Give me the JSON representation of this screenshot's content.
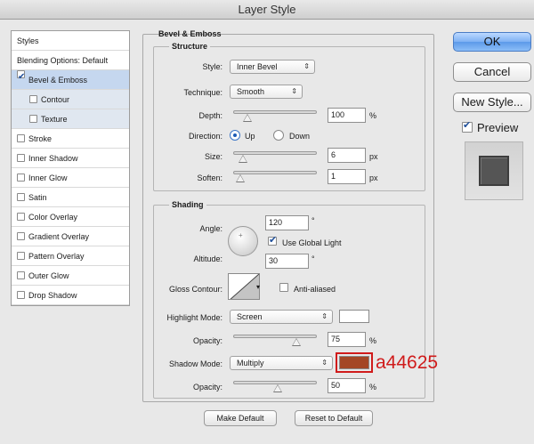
{
  "window": {
    "title": "Layer Style"
  },
  "left_list": {
    "items": [
      {
        "label": "Styles",
        "checkbox": false,
        "checked": false,
        "state": "header"
      },
      {
        "label": "Blending Options: Default",
        "checkbox": false,
        "checked": false,
        "state": "header"
      },
      {
        "label": "Bevel & Emboss",
        "checkbox": true,
        "checked": true,
        "state": "selected"
      },
      {
        "label": "Contour",
        "checkbox": true,
        "checked": false,
        "state": "sub"
      },
      {
        "label": "Texture",
        "checkbox": true,
        "checked": false,
        "state": "sub"
      },
      {
        "label": "Stroke",
        "checkbox": true,
        "checked": false,
        "state": "normal"
      },
      {
        "label": "Inner Shadow",
        "checkbox": true,
        "checked": false,
        "state": "normal"
      },
      {
        "label": "Inner Glow",
        "checkbox": true,
        "checked": false,
        "state": "normal"
      },
      {
        "label": "Satin",
        "checkbox": true,
        "checked": false,
        "state": "normal"
      },
      {
        "label": "Color Overlay",
        "checkbox": true,
        "checked": false,
        "state": "normal"
      },
      {
        "label": "Gradient Overlay",
        "checkbox": true,
        "checked": false,
        "state": "normal"
      },
      {
        "label": "Pattern Overlay",
        "checkbox": true,
        "checked": false,
        "state": "normal"
      },
      {
        "label": "Outer Glow",
        "checkbox": true,
        "checked": false,
        "state": "normal"
      },
      {
        "label": "Drop Shadow",
        "checkbox": true,
        "checked": false,
        "state": "normal"
      }
    ]
  },
  "bevel": {
    "title": "Bevel & Emboss",
    "structure": {
      "title": "Structure",
      "style_label": "Style:",
      "style_value": "Inner Bevel",
      "technique_label": "Technique:",
      "technique_value": "Smooth",
      "depth_label": "Depth:",
      "depth_value": "100",
      "depth_unit": "%",
      "direction_label": "Direction:",
      "direction_up": "Up",
      "direction_down": "Down",
      "size_label": "Size:",
      "size_value": "6",
      "size_unit": "px",
      "soften_label": "Soften:",
      "soften_value": "1",
      "soften_unit": "px"
    },
    "shading": {
      "title": "Shading",
      "angle_label": "Angle:",
      "angle_value": "120",
      "angle_unit": "°",
      "global_light_label": "Use Global Light",
      "altitude_label": "Altitude:",
      "altitude_value": "30",
      "altitude_unit": "°",
      "gloss_label": "Gloss Contour:",
      "anti_aliased_label": "Anti-aliased",
      "highlight_mode_label": "Highlight Mode:",
      "highlight_mode_value": "Screen",
      "highlight_opacity_label": "Opacity:",
      "highlight_opacity_value": "75",
      "highlight_opacity_unit": "%",
      "shadow_mode_label": "Shadow Mode:",
      "shadow_mode_value": "Multiply",
      "shadow_opacity_label": "Opacity:",
      "shadow_opacity_value": "50",
      "shadow_opacity_unit": "%"
    },
    "make_default": "Make Default",
    "reset_default": "Reset to Default"
  },
  "levels": {
    "depth": 0.1,
    "size": 0.03,
    "soften": 0.0,
    "highlight_opacity": 0.75,
    "shadow_opacity": 0.5
  },
  "colors": {
    "highlight": "#ffffff",
    "shadow": "#a44625",
    "annotation": "#d01b1b"
  },
  "annotation": {
    "text": "a44625"
  },
  "buttons": {
    "ok": "OK",
    "cancel": "Cancel",
    "new_style": "New Style...",
    "preview": "Preview"
  }
}
